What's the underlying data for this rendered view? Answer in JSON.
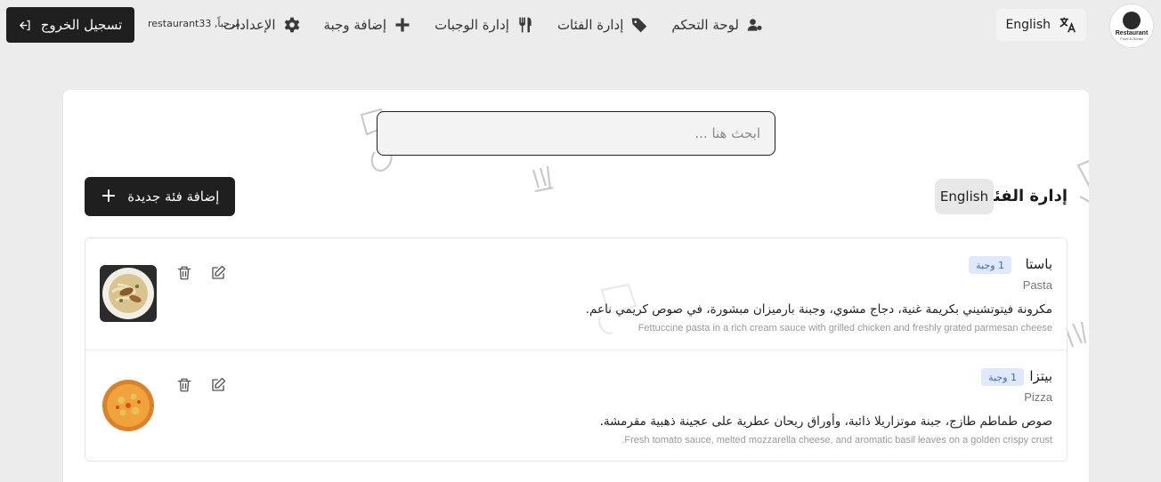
{
  "brand": {
    "name": "Restaurant",
    "tagline": "Food & Drinks"
  },
  "language_switch": {
    "label": "English"
  },
  "nav": [
    {
      "label": "لوحة التحكم",
      "icon": "users-gear-icon"
    },
    {
      "label": "إدارة الفئات",
      "icon": "tags-icon"
    },
    {
      "label": "إدارة الوجبات",
      "icon": "utensils-icon"
    },
    {
      "label": "إضافة وجبة",
      "icon": "plus-icon"
    },
    {
      "label": "الإعدادات",
      "icon": "gear-icon"
    }
  ],
  "user": {
    "welcome": "مرحباً, restaurant33"
  },
  "logout": {
    "label": "تسجيل الخروج",
    "icon": "sign-out-icon"
  },
  "search": {
    "placeholder": "ابحث هنا ..."
  },
  "categories_section": {
    "title": "إدارة الفئات",
    "language_label": "English",
    "add_button_label": "إضافة فئة جديدة"
  },
  "categories": [
    {
      "name_ar": "باستا",
      "name_en": "Pasta",
      "meal_count": "1 وجبة",
      "description_ar": "مكرونة فيتوتشيني بكريمة غنية، دجاج مشوي، وجبنة بارميزان مبشورة، في صوص كريمي ناعم.",
      "description_en": "Fettuccine pasta in a rich cream sauce with grilled chicken and freshly grated parmesan cheese",
      "image": "pasta-dish"
    },
    {
      "name_ar": "بيتزا",
      "name_en": "Pizza",
      "meal_count": "1 وجبة",
      "description_ar": "صوص طماطم طازج، جبنة موتزاريلا ذائبة، وأوراق ريحان عطرية على عجينة ذهبية مقرمشة.",
      "description_en": "Fresh tomato sauce, melted mozzarella cheese, and aromatic basil leaves on a golden crispy crust.",
      "image": "pizza-dish"
    }
  ],
  "colors": {
    "page_bg": "#ececec",
    "dark_button": "#1f1f1f",
    "badge_bg": "#dfe9fb",
    "badge_text": "#3f6bb5"
  }
}
